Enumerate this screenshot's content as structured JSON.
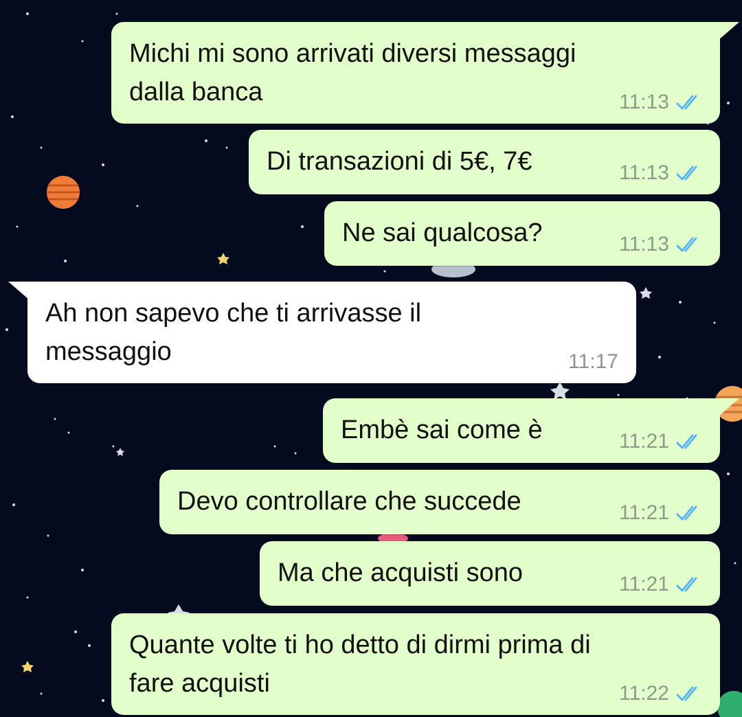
{
  "messages": [
    {
      "direction": "out",
      "text": "Michi mi sono arrivati diversi messaggi\ndalla banca",
      "time": "11:13",
      "status": "read"
    },
    {
      "direction": "out",
      "text": "Di transazioni di 5€, 7€",
      "time": "11:13",
      "status": "read"
    },
    {
      "direction": "out",
      "text": "Ne sai qualcosa?",
      "time": "11:13",
      "status": "read"
    },
    {
      "direction": "in",
      "text": "Ah non sapevo che ti arrivasse il\nmessaggio",
      "time": "11:17"
    },
    {
      "direction": "out",
      "text": "Embè sai come è",
      "time": "11:21",
      "status": "read"
    },
    {
      "direction": "out",
      "text": "Devo controllare che succede",
      "time": "11:21",
      "status": "read"
    },
    {
      "direction": "out",
      "text": "Ma che acquisti sono",
      "time": "11:21",
      "status": "read"
    },
    {
      "direction": "out",
      "text": "Quante volte ti ho detto di dirmi prima di\nfare acquisti",
      "time": "11:22",
      "status": "read"
    }
  ],
  "colors": {
    "outgoing_bubble": "#e2fecb",
    "incoming_bubble": "#ffffff",
    "read_ticks": "#4fb3f6",
    "wallpaper": "#050b1f"
  }
}
